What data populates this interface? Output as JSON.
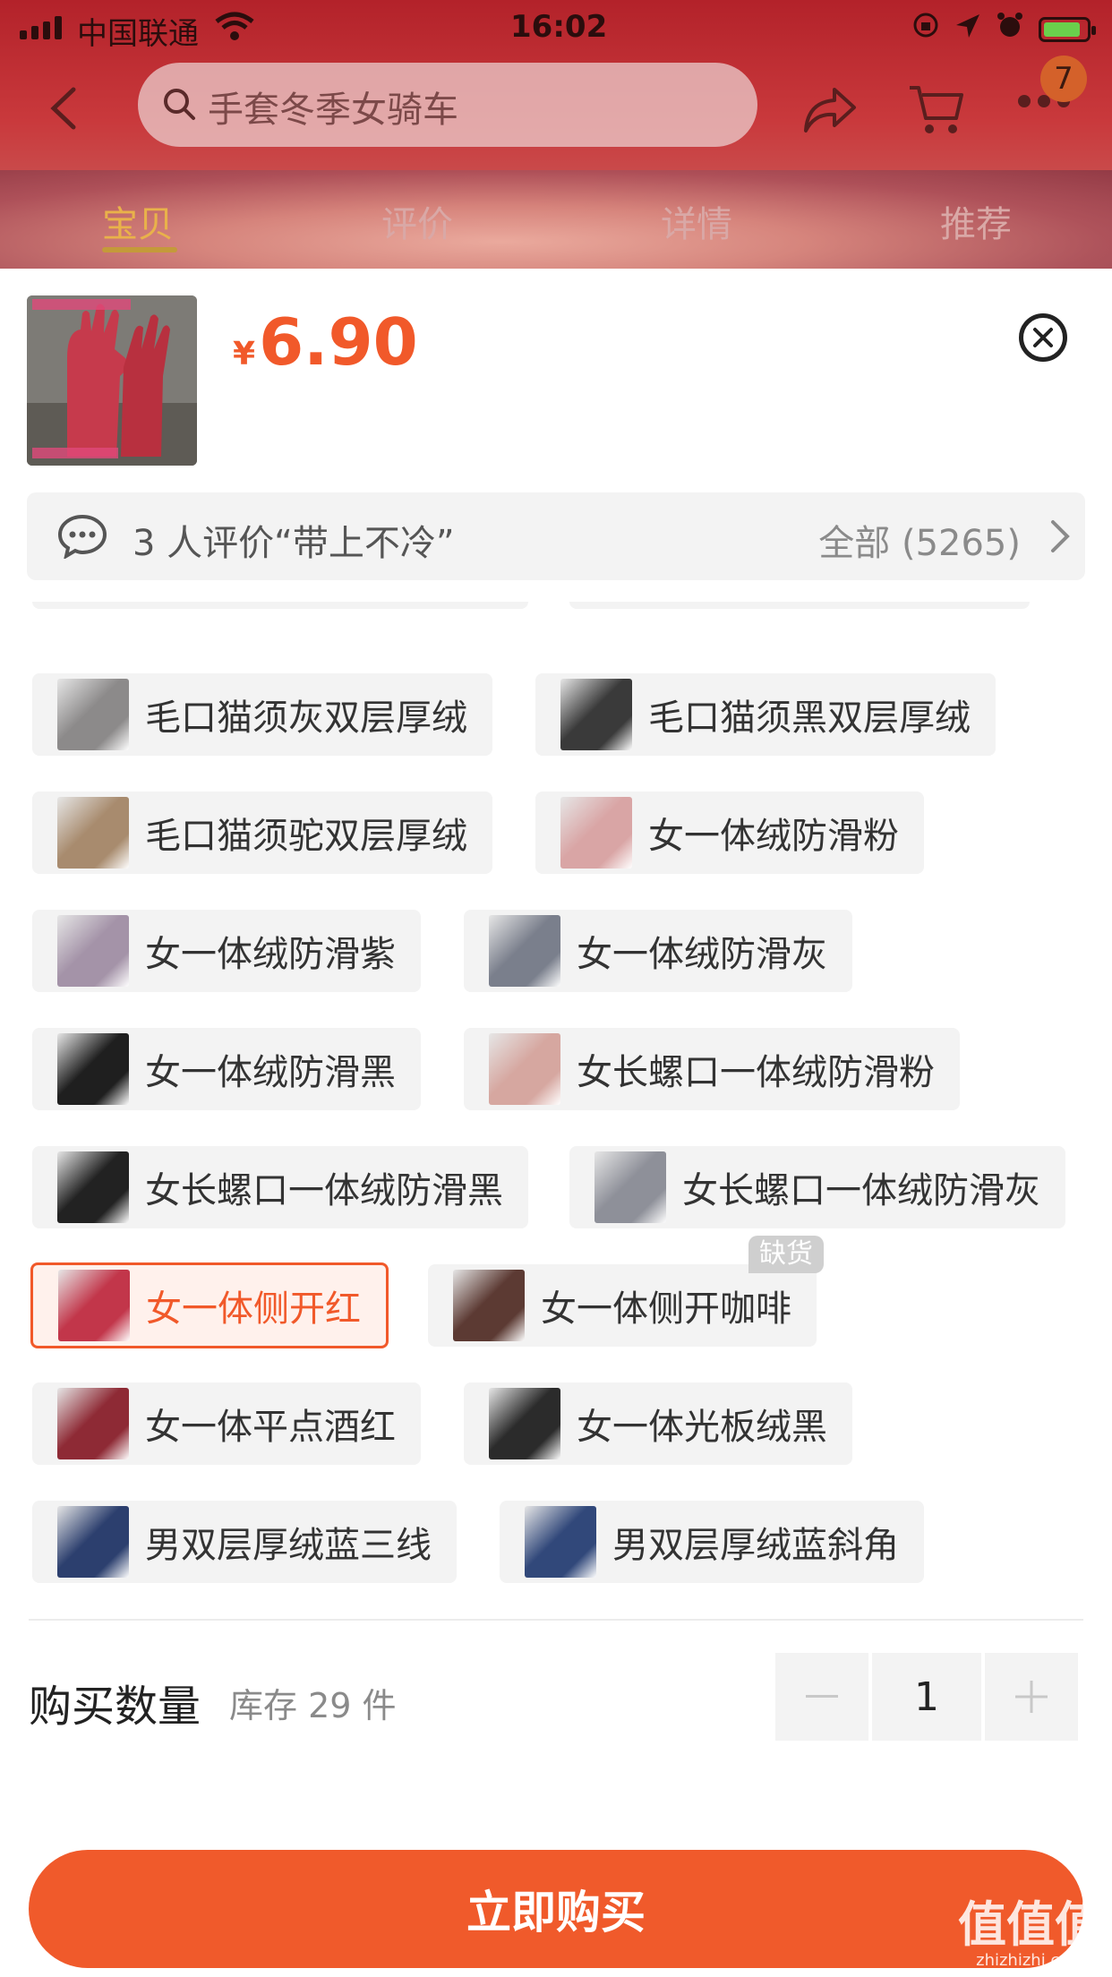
{
  "status_bar": {
    "carrier": "中国联通",
    "time": "16:02"
  },
  "nav": {
    "search_placeholder": "手套冬季女骑车",
    "cart_badge": "7"
  },
  "tabs": [
    {
      "label": "宝贝"
    },
    {
      "label": "评价"
    },
    {
      "label": "详情"
    },
    {
      "label": "推荐"
    }
  ],
  "sheet": {
    "currency": "¥",
    "price": "6.90",
    "review": {
      "text": "3 人评价“带上不冷”",
      "all": "全部 (5265)"
    }
  },
  "options": [
    {
      "label": "毛口猫须灰双层厚绒",
      "color": "#8c8a8a"
    },
    {
      "label": "毛口猫须黑双层厚绒",
      "color": "#3a3a3a"
    },
    {
      "label": "毛口猫须驼双层厚绒",
      "color": "#a88b6e"
    },
    {
      "label": "女一体绒防滑粉",
      "color": "#d9a5a5"
    },
    {
      "label": "女一体绒防滑紫",
      "color": "#a493a8"
    },
    {
      "label": "女一体绒防滑灰",
      "color": "#7a7f8c"
    },
    {
      "label": "女一体绒防滑黑",
      "color": "#1f1f1f"
    },
    {
      "label": "女长螺口一体绒防滑粉",
      "color": "#d6a7a0"
    },
    {
      "label": "女长螺口一体绒防滑黑",
      "color": "#222222"
    },
    {
      "label": "女长螺口一体绒防滑灰",
      "color": "#8e9099"
    },
    {
      "label": "女一体侧开红",
      "color": "#c2364a",
      "selected": true
    },
    {
      "label": "女一体侧开咖啡",
      "color": "#5c3a33",
      "soldout_label": "缺货"
    },
    {
      "label": "女一体平点酒红",
      "color": "#8e2a35"
    },
    {
      "label": "女一体光板绒黑",
      "color": "#2b2b2b"
    },
    {
      "label": "男双层厚绒蓝三线",
      "color": "#2c3f6e"
    },
    {
      "label": "男双层厚绒蓝斜角",
      "color": "#31487a"
    }
  ],
  "quantity": {
    "label": "购买数量",
    "stock": "库存 29 件",
    "value": "1"
  },
  "buy_button": "立即购买",
  "watermark": {
    "logo": "值值值",
    "site": "zhizhizhi.com"
  },
  "colors": {
    "accent": "#f05a2b",
    "selected_chip_bg": "#fff1ec",
    "chip_bg": "#f3f3f3"
  }
}
